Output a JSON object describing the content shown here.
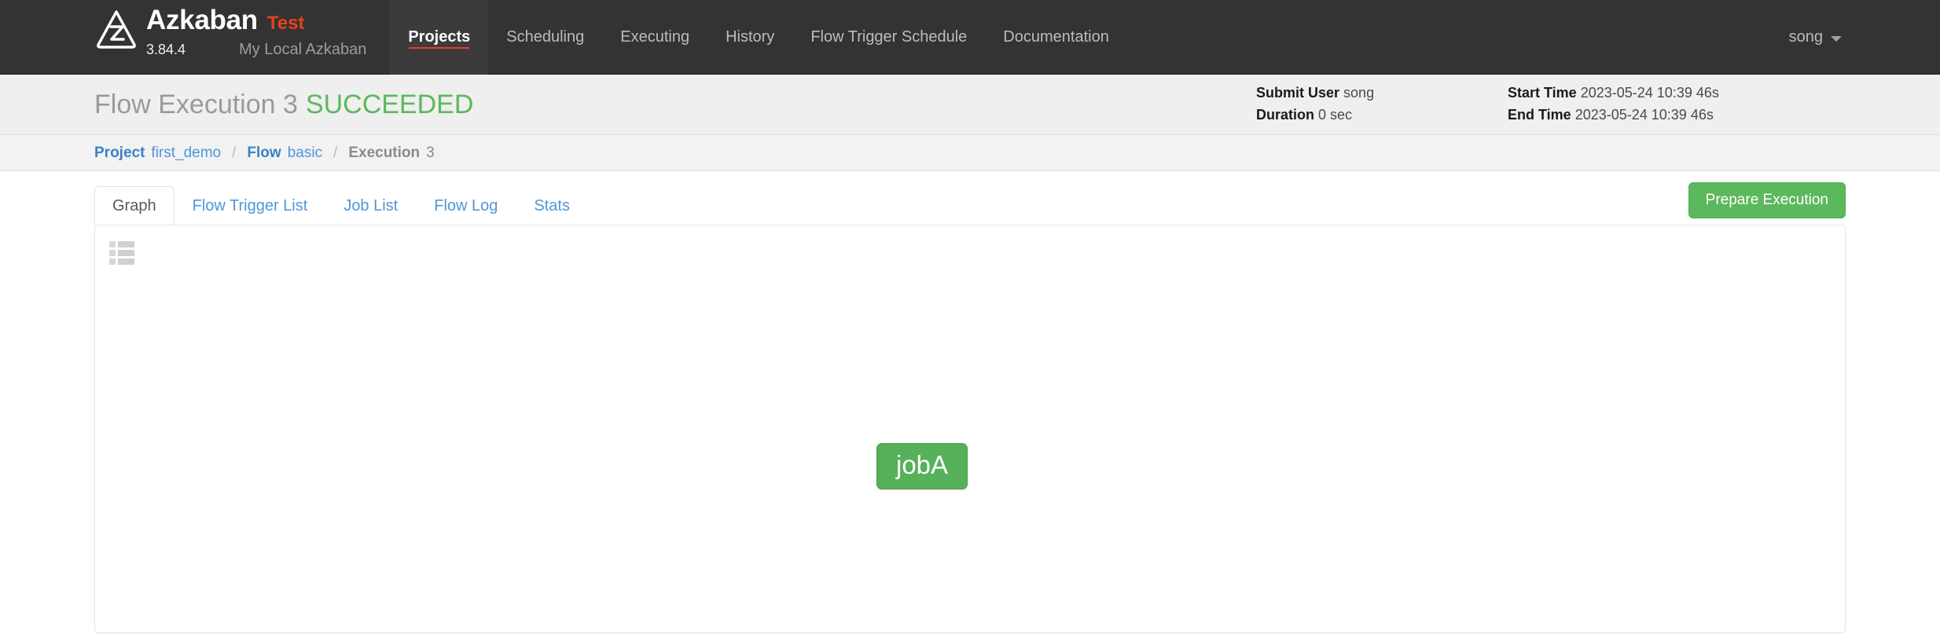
{
  "navbar": {
    "logo_icon": "azkaban-triangle-z-logo",
    "brand_name": "Azkaban",
    "environment": "Test",
    "version": "3.84.4",
    "subtitle": "My Local Azkaban",
    "links": [
      {
        "label": "Projects",
        "active": true
      },
      {
        "label": "Scheduling",
        "active": false
      },
      {
        "label": "Executing",
        "active": false
      },
      {
        "label": "History",
        "active": false
      },
      {
        "label": "Flow Trigger Schedule",
        "active": false
      },
      {
        "label": "Documentation",
        "active": false
      }
    ],
    "user": "song",
    "user_caret_icon": "chevron-down-icon"
  },
  "exec_header": {
    "title_prefix": "Flow Execution 3",
    "status": "SUCCEEDED",
    "meta": {
      "submit_user_label": "Submit User",
      "submit_user_value": "song",
      "duration_label": "Duration",
      "duration_value": "0 sec",
      "start_time_label": "Start Time",
      "start_time_value": "2023-05-24 10:39 46s",
      "end_time_label": "End Time",
      "end_time_value": "2023-05-24 10:39 46s"
    }
  },
  "breadcrumb": {
    "separator": "/",
    "items": [
      {
        "label": "Project",
        "value": "first_demo",
        "current": false
      },
      {
        "label": "Flow",
        "value": "basic",
        "current": false
      },
      {
        "label": "Execution",
        "value": "3",
        "current": true
      }
    ]
  },
  "tabs": [
    {
      "label": "Graph",
      "active": true
    },
    {
      "label": "Flow Trigger List",
      "active": false
    },
    {
      "label": "Job List",
      "active": false
    },
    {
      "label": "Flow Log",
      "active": false
    },
    {
      "label": "Stats",
      "active": false
    }
  ],
  "actions": {
    "prepare_execution_label": "Prepare Execution"
  },
  "graph": {
    "menu_icon": "list-menu-icon",
    "nodes": [
      {
        "label": "jobA",
        "status": "succeeded"
      }
    ]
  },
  "colors": {
    "navbar_bg": "#333333",
    "accent_orange": "#e8401c",
    "success_green": "#5cb85c",
    "node_green": "#57b05a",
    "link_blue": "#4f96d8"
  }
}
